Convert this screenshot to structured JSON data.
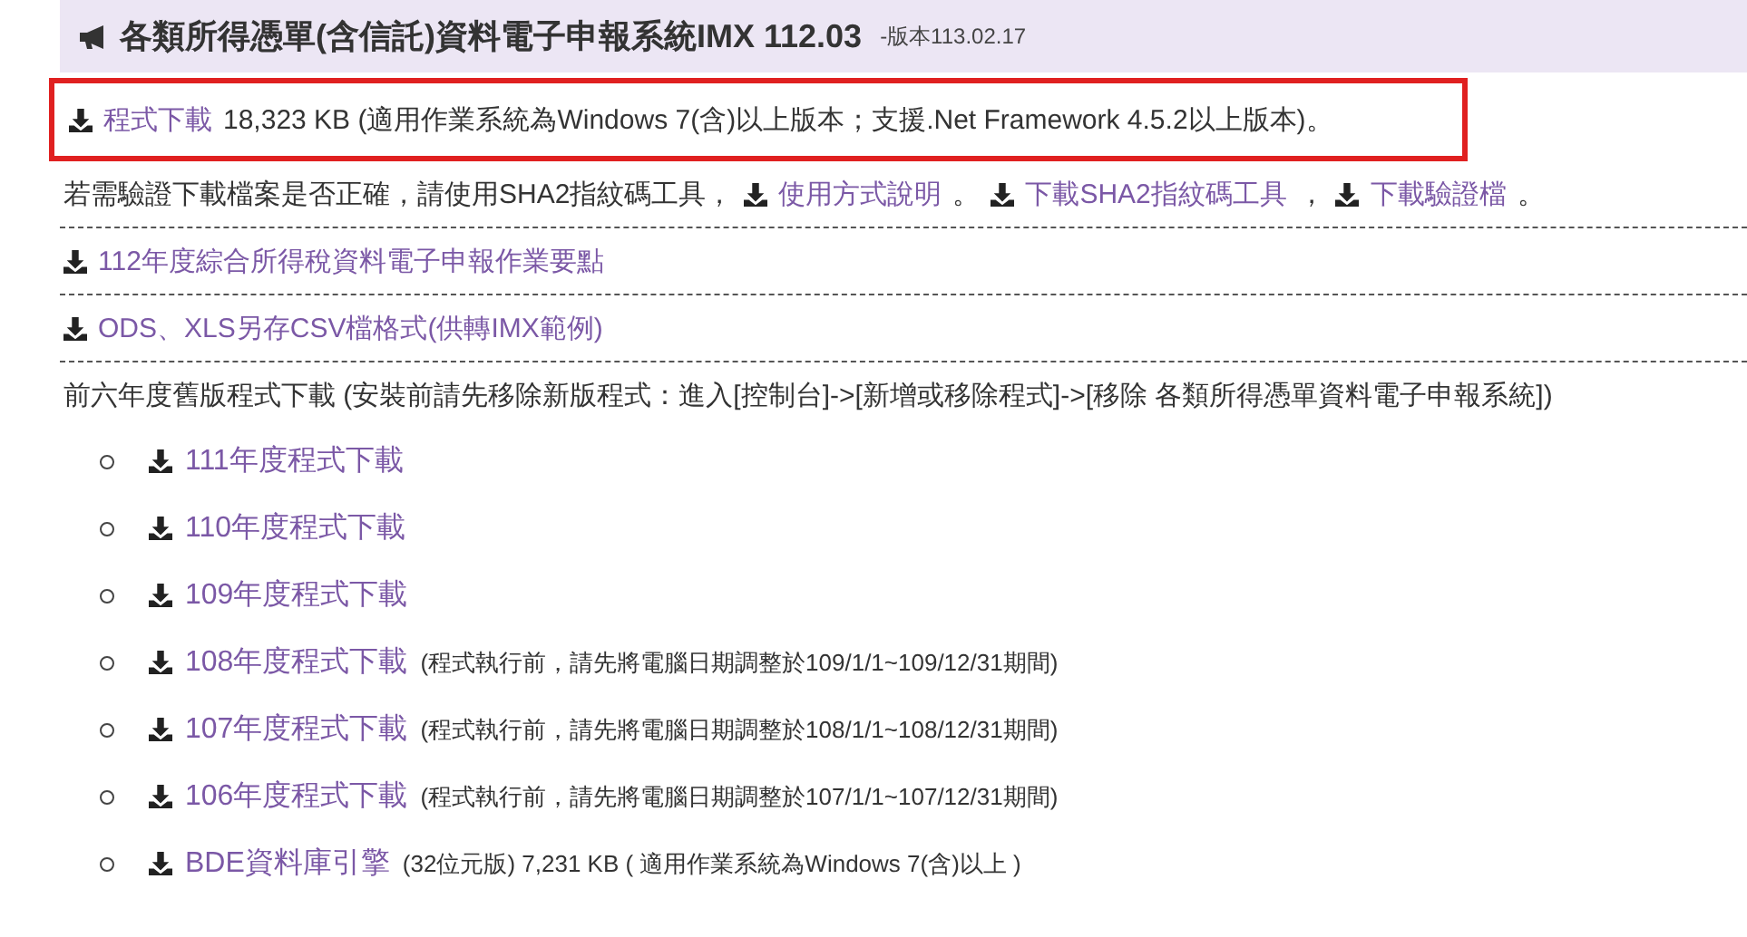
{
  "header": {
    "title": "各類所得憑單(含信託)資料電子申報系統IMX 112.03",
    "version": "-版本113.02.17"
  },
  "main_download": {
    "link": "程式下載",
    "detail": "18,323 KB (適用作業系統為Windows 7(含)以上版本；支援.Net Framework 4.5.2以上版本)。",
    "highlighted": true
  },
  "verify": [
    {
      "kind": "text",
      "text": "若需驗證下載檔案是否正確，請使用SHA2指紋碼工具，"
    },
    {
      "kind": "link",
      "text": "使用方式說明"
    },
    {
      "kind": "text",
      "text": "。"
    },
    {
      "kind": "link",
      "text": "下載SHA2指紋碼工具"
    },
    {
      "kind": "text",
      "text": "，"
    },
    {
      "kind": "link",
      "text": "下載驗證檔"
    },
    {
      "kind": "text",
      "text": "。"
    }
  ],
  "resources": [
    {
      "link": "112年度綜合所得稅資料電子申報作業要點"
    },
    {
      "link": "ODS、XLS另存CSV檔格式(供轉IMX範例)"
    }
  ],
  "old_versions": {
    "intro": "前六年度舊版程式下載 (安裝前請先移除新版程式：進入[控制台]->[新增或移除程式]->[移除 各類所得憑單資料電子申報系統])",
    "items": [
      {
        "link": "111年度程式下載"
      },
      {
        "link": "110年度程式下載"
      },
      {
        "link": "109年度程式下載"
      },
      {
        "link": "108年度程式下載",
        "note": "(程式執行前，請先將電腦日期調整於109/1/1~109/12/31期間)"
      },
      {
        "link": "107年度程式下載",
        "note": "(程式執行前，請先將電腦日期調整於108/1/1~108/12/31期間)"
      },
      {
        "link": "106年度程式下載",
        "note": "(程式執行前，請先將電腦日期調整於107/1/1~107/12/31期間)"
      },
      {
        "link": "BDE資料庫引擎",
        "note": "(32位元版) 7,231 KB ( 適用作業系統為Windows 7(含)以上 )"
      }
    ]
  }
}
